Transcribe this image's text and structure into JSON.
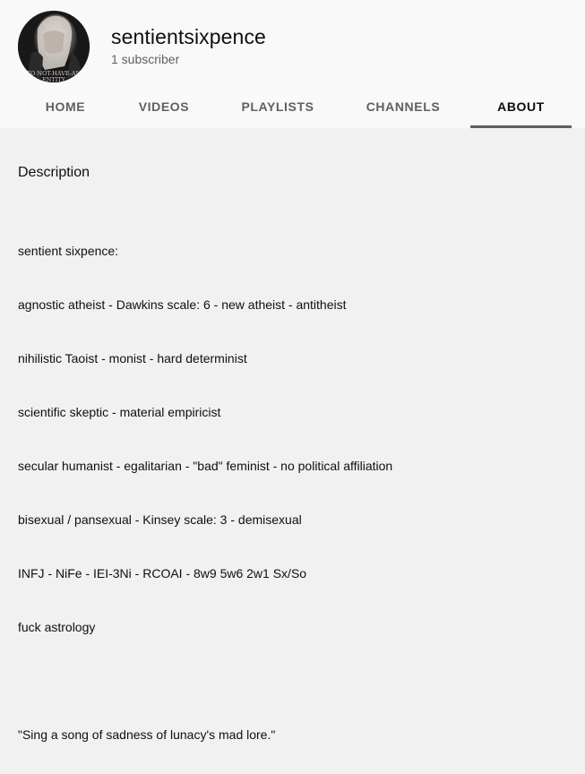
{
  "channel": {
    "name": "sentientsixpence",
    "subscribers": "1 subscriber",
    "avatar_text": "TO NOT-HAVE-AN ENTITY"
  },
  "tabs": [
    {
      "label": "HOME"
    },
    {
      "label": "VIDEOS"
    },
    {
      "label": "PLAYLISTS"
    },
    {
      "label": "CHANNELS"
    },
    {
      "label": "ABOUT",
      "active": true
    }
  ],
  "about": {
    "heading": "Description",
    "lines": [
      "sentient sixpence:",
      "agnostic atheist - Dawkins scale: 6 - new atheist - antitheist",
      "nihilistic Taoist - monist - hard determinist",
      "scientific skeptic - material empiricist",
      "secular humanist - egalitarian - \"bad\" feminist - no political affiliation",
      "bisexual / pansexual - Kinsey scale: 3 - demisexual",
      "INFJ - NiFe - IEI-3Ni - RCOAI - 8w9 5w6 2w1 Sx/So",
      "fuck astrology",
      "",
      "\"Sing a song of sadness of lunacy's mad lore.\""
    ]
  },
  "colors": {
    "page_bg": "#f1f1f1",
    "header_bg": "#f9f9f9",
    "text_primary": "#0f0f0f",
    "text_secondary": "#606060"
  }
}
